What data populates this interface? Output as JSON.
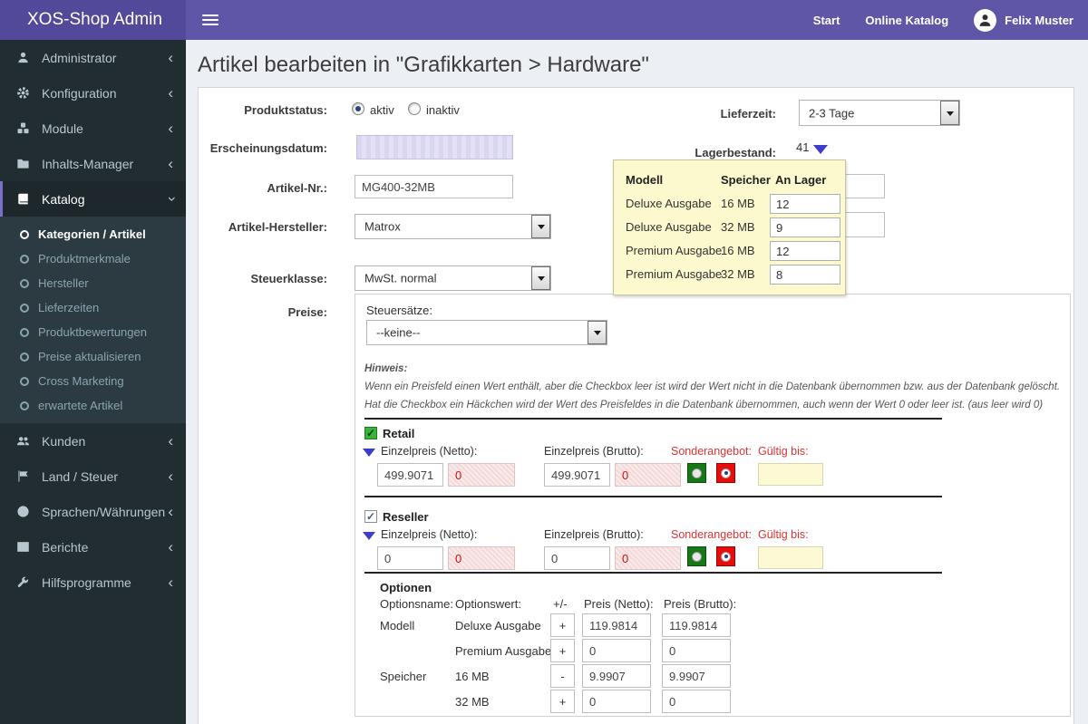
{
  "header": {
    "brand": "XOS-Shop Admin",
    "nav": {
      "start": "Start",
      "online_katalog": "Online Katalog",
      "user": "Felix Muster"
    }
  },
  "icons": {
    "administrator": "user-icon",
    "konfiguration": "gear-icon",
    "module": "cubes-icon",
    "inhalts_manager": "folder-icon",
    "katalog": "book-icon",
    "kunden": "users-icon",
    "land_steuer": "flag-icon",
    "sprachen": "language-icon",
    "berichte": "table-icon",
    "hilfsprogramme": "wrench-icon",
    "menu_toggle": "hamburger-icon",
    "user": "avatar-icon",
    "collapsed": "chevron-left-icon",
    "expanded": "chevron-down-icon",
    "stock_toggle": "caret-down-icon",
    "price_toggle": "caret-down-icon"
  },
  "sidebar": {
    "items": [
      {
        "label": "Administrator"
      },
      {
        "label": "Konfiguration"
      },
      {
        "label": "Module"
      },
      {
        "label": "Inhalts-Manager"
      },
      {
        "label": "Katalog"
      },
      {
        "label": "Kunden"
      },
      {
        "label": "Land / Steuer"
      },
      {
        "label": "Sprachen/Währungen"
      },
      {
        "label": "Berichte"
      },
      {
        "label": "Hilfsprogramme"
      }
    ],
    "katalog_children": [
      {
        "label": "Kategorien / Artikel",
        "active": true
      },
      {
        "label": "Produktmerkmale"
      },
      {
        "label": "Hersteller"
      },
      {
        "label": "Lieferzeiten"
      },
      {
        "label": "Produktbewertungen"
      },
      {
        "label": "Preise aktualisieren"
      },
      {
        "label": "Cross Marketing"
      },
      {
        "label": "erwartete Artikel"
      }
    ]
  },
  "page": {
    "title": "Artikel bearbeiten in \"Grafikkarten > Hardware\""
  },
  "form": {
    "produktstatus_label": "Produktstatus:",
    "produktstatus_options": [
      "aktiv",
      "inaktiv"
    ],
    "produktstatus_selected": "aktiv",
    "erscheinungsdatum_label": "Erscheinungsdatum:",
    "erscheinungsdatum_value": "",
    "artikel_nr_label": "Artikel-Nr.:",
    "artikel_nr_value": "MG400-32MB",
    "hersteller_label": "Artikel-Hersteller:",
    "hersteller_value": "Matrox",
    "steuerklasse_label": "Steuerklasse:",
    "steuerklasse_value": "MwSt. normal",
    "lieferzeit_label": "Lieferzeit:",
    "lieferzeit_value": "2-3 Tage",
    "lagerbestand_label": "Lagerbestand:",
    "lagerbestand_value": "41",
    "obscured_field_1": "",
    "obscured_field_2": ""
  },
  "stock_popup": {
    "columns": {
      "modell": "Modell",
      "speicher": "Speicher",
      "an_lager": "An Lager"
    },
    "rows": [
      {
        "modell": "Deluxe Ausgabe",
        "speicher": "16 MB",
        "an_lager": "12"
      },
      {
        "modell": "Deluxe Ausgabe",
        "speicher": "32 MB",
        "an_lager": "9"
      },
      {
        "modell": "Premium Ausgabe",
        "speicher": "16 MB",
        "an_lager": "12"
      },
      {
        "modell": "Premium Ausgabe",
        "speicher": "32 MB",
        "an_lager": "8"
      }
    ]
  },
  "preise": {
    "label": "Preise:",
    "steuersaetze_label": "Steuersätze:",
    "steuersaetze_value": "--keine--",
    "hinweis_title": "Hinweis:",
    "hinweis_line1": "Wenn ein Preisfeld einen Wert enthält, aber die Checkbox leer ist wird der Wert nicht in die Datenbank übernommen bzw. aus der Datenbank gelöscht.",
    "hinweis_line2": "Hat die Checkbox ein Häckchen wird der Wert des Preisfeldes in die Datenbank übernommen, auch wenn der Wert 0 oder leer ist. (aus leer wird 0)",
    "netto_label": "Einzelpreis (Netto):",
    "brutto_label": "Einzelpreis (Brutto):",
    "sonderangebot_label": "Sonderangebot:",
    "gueltig_label": "Gültig bis:",
    "groups": [
      {
        "name": "Retail",
        "netto": "499.9071",
        "netto_alt": "0",
        "brutto": "499.9071",
        "brutto_alt": "0",
        "gueltig": ""
      },
      {
        "name": "Reseller",
        "netto": "0",
        "netto_alt": "0",
        "brutto": "0",
        "brutto_alt": "0",
        "gueltig": ""
      }
    ]
  },
  "optionen": {
    "title": "Optionen",
    "headers": {
      "name": "Optionsname:",
      "wert": "Optionswert:",
      "pm": "+/-",
      "netto": "Preis (Netto):",
      "brutto": "Preis (Brutto):"
    },
    "rows": [
      {
        "name": "Modell",
        "wert": "Deluxe Ausgabe",
        "pm": "+",
        "netto": "119.9814",
        "brutto": "119.9814"
      },
      {
        "name": "",
        "wert": "Premium Ausgabe",
        "pm": "+",
        "netto": "0",
        "brutto": "0"
      },
      {
        "name": "Speicher",
        "wert": "16 MB",
        "pm": "-",
        "netto": "9.9907",
        "brutto": "9.9907"
      },
      {
        "name": "",
        "wert": "32 MB",
        "pm": "+",
        "netto": "0",
        "brutto": "0"
      }
    ]
  },
  "colors": {
    "brand_bg": "#53499a",
    "header_bg": "#5f56a7",
    "sidebar_bg": "#222d32",
    "submenu_bg": "#2c3b41",
    "accent": "#7a6ec9",
    "content_bg": "#ecf0f5",
    "popup_bg": "#fbf9cd",
    "alert_red": "#dd3333",
    "special_green": "#157915",
    "special_red": "#e80c0c"
  }
}
